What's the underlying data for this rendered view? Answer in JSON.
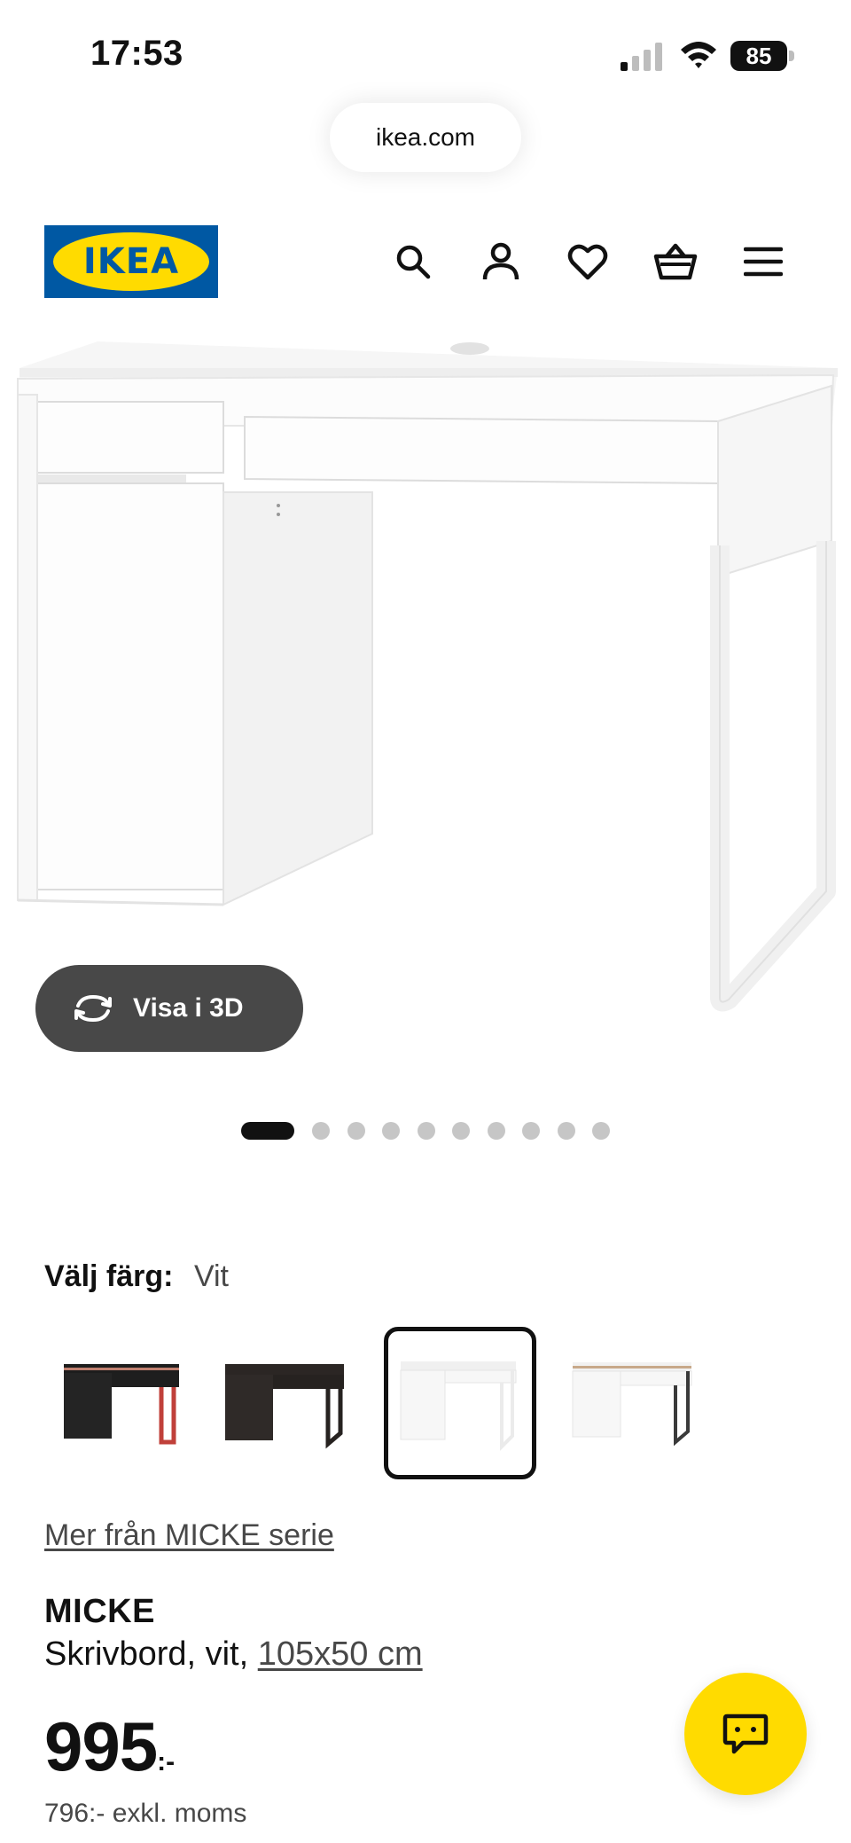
{
  "status_bar": {
    "time": "17:53",
    "battery": "85"
  },
  "browser": {
    "url": "ikea.com"
  },
  "header": {
    "logo_text": "IKEA",
    "icons": [
      "search-icon",
      "account-icon",
      "heart-icon",
      "basket-icon",
      "menu-icon"
    ]
  },
  "gallery": {
    "view_3d_label": "Visa i 3D",
    "total_images": 10,
    "active_index": 0
  },
  "color": {
    "label": "Välj färg:",
    "value": "Vit",
    "options": [
      {
        "name": "svart/röd",
        "selected": false
      },
      {
        "name": "svartbrun",
        "selected": false
      },
      {
        "name": "vit",
        "selected": true
      },
      {
        "name": "vit/ekeffekt",
        "selected": false
      }
    ]
  },
  "product": {
    "series_link": "Mer från MICKE serie",
    "name": "MICKE",
    "description": "Skrivbord, vit,",
    "size": "105x50 cm",
    "price": "995",
    "price_suffix": ":-",
    "price_ex_vat": "796:- exkl. moms"
  },
  "colors": {
    "ikea_blue": "#0058a3",
    "ikea_yellow": "#ffdb00",
    "dark_button": "#484848",
    "text": "#111111"
  }
}
